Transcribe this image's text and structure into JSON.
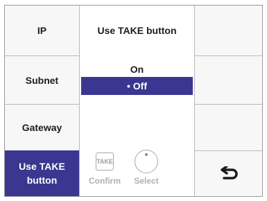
{
  "menu_left": [
    {
      "label": "IP"
    },
    {
      "label": "Subnet"
    },
    {
      "label": "Gateway"
    },
    {
      "label": "Use TAKE button"
    }
  ],
  "panel": {
    "title": "Use TAKE button",
    "options": [
      {
        "label": "On",
        "selected": false
      },
      {
        "label": "• Off",
        "selected": true
      }
    ]
  },
  "controls": {
    "take_icon_text": "TAKE",
    "confirm_label": "Confirm",
    "select_label": "Select"
  },
  "icons": {
    "back": "return-arrow-icon",
    "take": "take-button-icon",
    "knob": "select-knob-icon"
  },
  "colors": {
    "accent": "#3b3790",
    "cell_bg": "#f7f7f7",
    "disabled": "#b0b0b0"
  }
}
